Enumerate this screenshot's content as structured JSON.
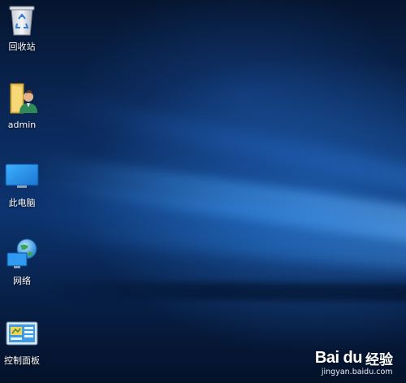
{
  "desktop": {
    "icons": [
      {
        "id": "recycle-bin",
        "label": "回收站",
        "icon": "recycle-bin-icon"
      },
      {
        "id": "user-folder",
        "label": "admin",
        "icon": "user-folder-icon"
      },
      {
        "id": "this-pc",
        "label": "此电脑",
        "icon": "monitor-icon"
      },
      {
        "id": "network",
        "label": "网络",
        "icon": "network-globe-icon"
      },
      {
        "id": "control-panel",
        "label": "控制面板",
        "icon": "control-panel-icon"
      }
    ]
  },
  "watermark": {
    "logo": "Bai du",
    "brand": "经验",
    "url": "jingyan.baidu.com"
  },
  "colors": {
    "wallpaper_dark": "#05152f",
    "wallpaper_light": "#2f86df",
    "label_text": "#ffffff"
  }
}
